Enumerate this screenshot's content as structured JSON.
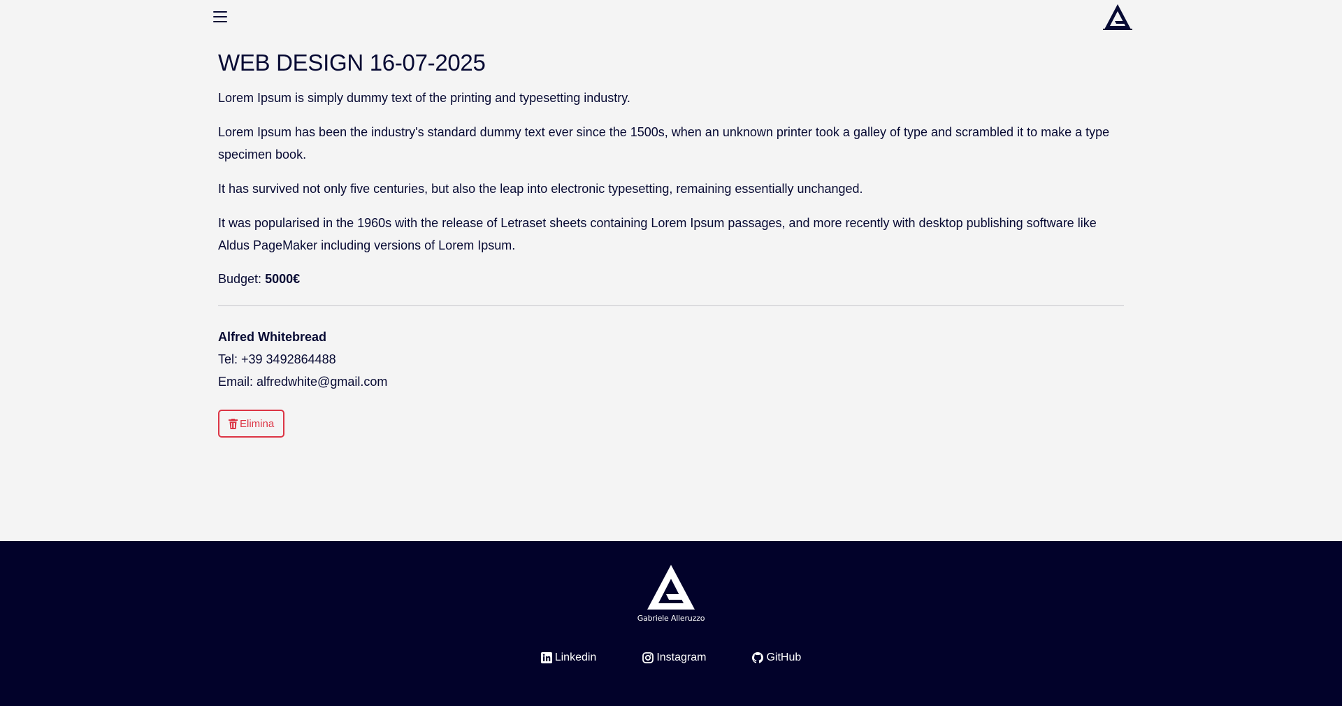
{
  "header": {
    "menu_icon": "hamburger-menu-icon",
    "logo_icon": "ga-triangle-logo-icon"
  },
  "project": {
    "title": "WEB DESIGN 16-07-2025",
    "paragraphs": [
      "Lorem Ipsum is simply dummy text of the printing and typesetting industry.",
      "Lorem Ipsum has been the industry's standard dummy text ever since the 1500s, when an unknown printer took a galley of type and scrambled it to make a type specimen book.",
      "It has survived not only five centuries, but also the leap into electronic typesetting, remaining essentially unchanged.",
      "It was popularised in the 1960s with the release of Letraset sheets containing Lorem Ipsum passages, and more recently with desktop publishing software like Aldus PageMaker including versions of Lorem Ipsum."
    ],
    "budget_label": "Budget:",
    "budget_value": "5000€"
  },
  "contact": {
    "name": "Alfred Whitebread",
    "tel": "Tel: +39 3492864488",
    "email": "Email: alfredwhite@gmail.com"
  },
  "actions": {
    "delete_label": "Elimina",
    "delete_icon": "trash-icon"
  },
  "footer": {
    "logo_caption": "Gabriele Alleruzzo",
    "links": [
      {
        "label": "Linkedin",
        "icon": "linkedin-icon"
      },
      {
        "label": "Instagram",
        "icon": "instagram-icon"
      },
      {
        "label": "GitHub",
        "icon": "github-icon"
      }
    ]
  },
  "colors": {
    "navy": "#070a33",
    "footer_bg": "#02022a",
    "danger": "#dc3545",
    "page_bg": "#f4f4f4"
  }
}
